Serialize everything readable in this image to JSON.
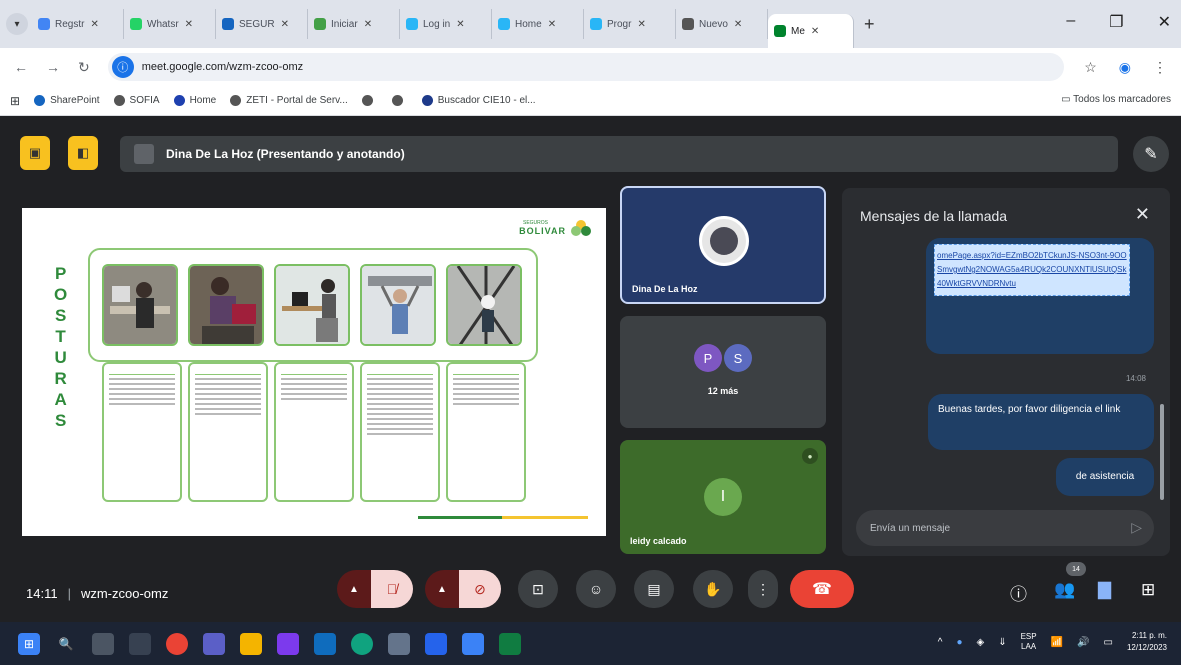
{
  "browser": {
    "tabs": [
      {
        "label": "Regstr",
        "color": "#4285f4"
      },
      {
        "label": "Whatsr",
        "color": "#25d366"
      },
      {
        "label": "SEGUR",
        "color": "#1565c0"
      },
      {
        "label": "Iniciar",
        "color": "#43a047"
      },
      {
        "label": "Log in",
        "color": "#29b6f6"
      },
      {
        "label": "Home",
        "color": "#29b6f6"
      },
      {
        "label": "Progr",
        "color": "#29b6f6"
      },
      {
        "label": "Nuevo",
        "color": "#555555"
      },
      {
        "label": "Me",
        "color": "#00832d"
      }
    ],
    "url": "meet.google.com/wzm-zcoo-omz",
    "bookmarks": [
      "SharePoint",
      "SOFIA",
      "Home",
      "ZETI - Portal de Serv...",
      "",
      "",
      "Buscador CIE10 - el..."
    ],
    "all_bookmarks": "Todos los marcadores"
  },
  "meet": {
    "presenter": "Dina De La Hoz (Presentando y anotando)",
    "slide": {
      "brand_small": "SEGUROS",
      "brand": "BOLIVAR",
      "vertical_word": [
        "P",
        "O",
        "S",
        "T",
        "U",
        "R",
        "A",
        "S"
      ]
    },
    "participants": {
      "main_name": "Dina De La Hoz",
      "group_initials": [
        "P",
        "S"
      ],
      "more": "12 más",
      "third_initial": "I",
      "third_name": "leidy calcado"
    },
    "chat": {
      "title": "Mensajes de la llamada",
      "link_text": "omePage.aspx?id=EZmBO2bTCkunJS-NSO3nt-9OOSmvgwtNg2NOWAG5a4RUQk2COUNXNTlUSUtQSk40WktGRVVNDRNvtu",
      "time": "14:08",
      "msg1": "Buenas tardes, por favor diligencia el link",
      "msg2": "de asistencia",
      "input_placeholder": "Envía un mensaje"
    },
    "meeting_time": "14:11",
    "meeting_code": "wzm-zcoo-omz",
    "people_badge": "14"
  },
  "taskbar": {
    "lang": "ESP",
    "lang2": "LAA",
    "time": "2:11 p. m.",
    "date": "12/12/2023"
  },
  "colors": {
    "accent_yellow": "#f8c11f",
    "hangup_red": "#ea4335",
    "brand_green": "#2f8a3b"
  }
}
